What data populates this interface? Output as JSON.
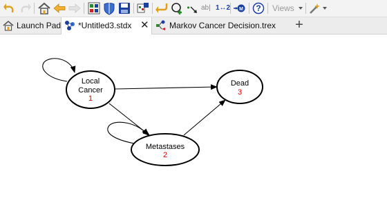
{
  "toolbar": {
    "colors": {
      "arrow": "#e0a020",
      "nav": "#f0b030",
      "blue": "#1a3fa0",
      "green": "#2a8a2a"
    },
    "buttons": [
      {
        "name": "undo-button",
        "icon": "undo-icon"
      },
      {
        "name": "redo-button",
        "icon": "redo-icon"
      },
      {
        "name": "home-button",
        "icon": "home-icon"
      },
      {
        "name": "back-button",
        "icon": "back-arrow-icon"
      },
      {
        "name": "forward-button",
        "icon": "forward-arrow-icon"
      },
      {
        "name": "model-button",
        "icon": "model-icon"
      },
      {
        "name": "shield-button",
        "icon": "shield-icon"
      },
      {
        "name": "save-button",
        "icon": "save-icon"
      },
      {
        "name": "node-add-button",
        "icon": "node-add-icon"
      },
      {
        "name": "return-button",
        "icon": "return-arrow-icon"
      },
      {
        "name": "add-state-button",
        "icon": "add-state-icon"
      },
      {
        "name": "add-transition-button",
        "icon": "add-transition-icon"
      },
      {
        "name": "text-tool-button",
        "icon": "text-tool-icon"
      },
      {
        "name": "renumber-button",
        "icon": "renumber-icon"
      },
      {
        "name": "markov-button",
        "icon": "markov-icon"
      },
      {
        "name": "help-button",
        "icon": "help-icon"
      },
      {
        "name": "tools-button",
        "icon": "wand-icon"
      }
    ],
    "text_tool_label": "ab|",
    "renumber_label": "1↔2",
    "help_label": "?",
    "views_label": "Views"
  },
  "tabs": [
    {
      "label": "Launch Pad",
      "icon": "launch-pad-icon",
      "active": false
    },
    {
      "label": "*Untitled3.stdx",
      "icon": "state-diagram-icon",
      "active": true,
      "close": "✕"
    },
    {
      "label": "Markov Cancer Decision.trex",
      "icon": "decision-tree-icon",
      "active": false
    }
  ],
  "add_tab_label": "+",
  "diagram": {
    "nodes": [
      {
        "id": "local-cancer",
        "label_line1": "Local",
        "label_line2": "Cancer",
        "number": "1"
      },
      {
        "id": "metastases",
        "label": "Metastases",
        "number": "2"
      },
      {
        "id": "dead",
        "label": "Dead",
        "number": "3"
      }
    ],
    "edges": [
      {
        "from": "local-cancer",
        "to": "local-cancer"
      },
      {
        "from": "local-cancer",
        "to": "dead"
      },
      {
        "from": "local-cancer",
        "to": "metastases"
      },
      {
        "from": "metastases",
        "to": "metastases"
      },
      {
        "from": "metastases",
        "to": "dead"
      }
    ],
    "number_color": "#d00000"
  }
}
